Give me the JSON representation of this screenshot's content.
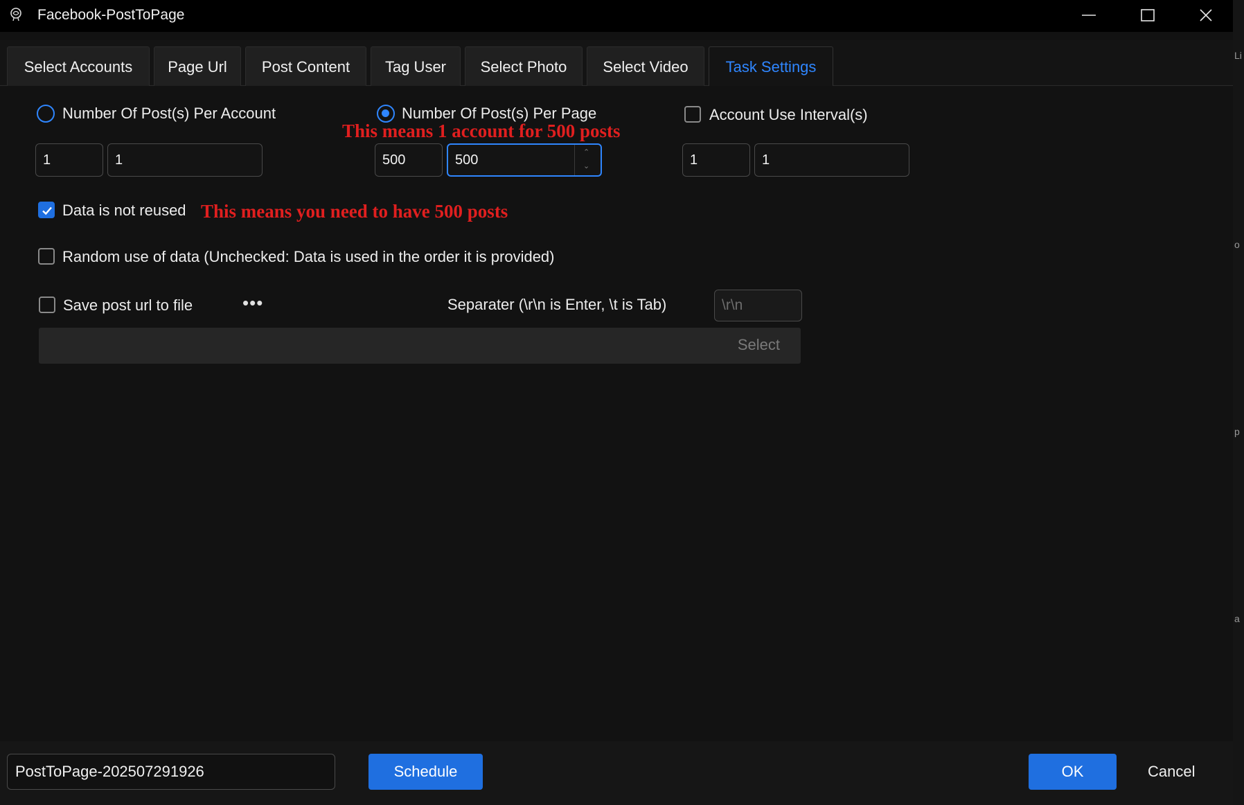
{
  "window": {
    "title": "Facebook-PostToPage"
  },
  "tabs": [
    {
      "label": "Select Accounts"
    },
    {
      "label": "Page Url"
    },
    {
      "label": "Post Content"
    },
    {
      "label": "Tag User"
    },
    {
      "label": "Select Photo"
    },
    {
      "label": "Select Video"
    },
    {
      "label": "Task Settings",
      "active": true
    }
  ],
  "settings": {
    "per_account": {
      "label": "Number Of Post(s) Per Account",
      "selected": false,
      "min": "1",
      "max": "1"
    },
    "per_page": {
      "label": "Number Of Post(s) Per Page",
      "selected": true,
      "min": "500",
      "max": "500"
    },
    "interval": {
      "label": "Account Use Interval(s)",
      "checked": false,
      "min": "1",
      "max": "1"
    },
    "data_not_reused": {
      "label": "Data is not reused",
      "checked": true
    },
    "random_use": {
      "label": "Random use of data (Unchecked: Data is used in the order it is provided)",
      "checked": false
    },
    "save_url": {
      "label": "Save post url to file",
      "checked": false,
      "more": "•••"
    },
    "separator": {
      "label": "Separater (\\r\\n is Enter, \\t is Tab)",
      "placeholder": "\\r\\n"
    },
    "file_path": {
      "value": "",
      "button": "Select"
    }
  },
  "annotations": {
    "per_page_note": "This means 1 account for 500 posts",
    "reuse_note": "This means you need to have 500 posts"
  },
  "footer": {
    "task_name": "PostToPage-202507291926",
    "schedule_label": "Schedule",
    "ok_label": "OK",
    "cancel_label": "Cancel"
  },
  "colors": {
    "accent": "#1f6fe0",
    "active_tab_text": "#2f86ff",
    "annotation": "#e01f1f",
    "background": "#121212"
  }
}
